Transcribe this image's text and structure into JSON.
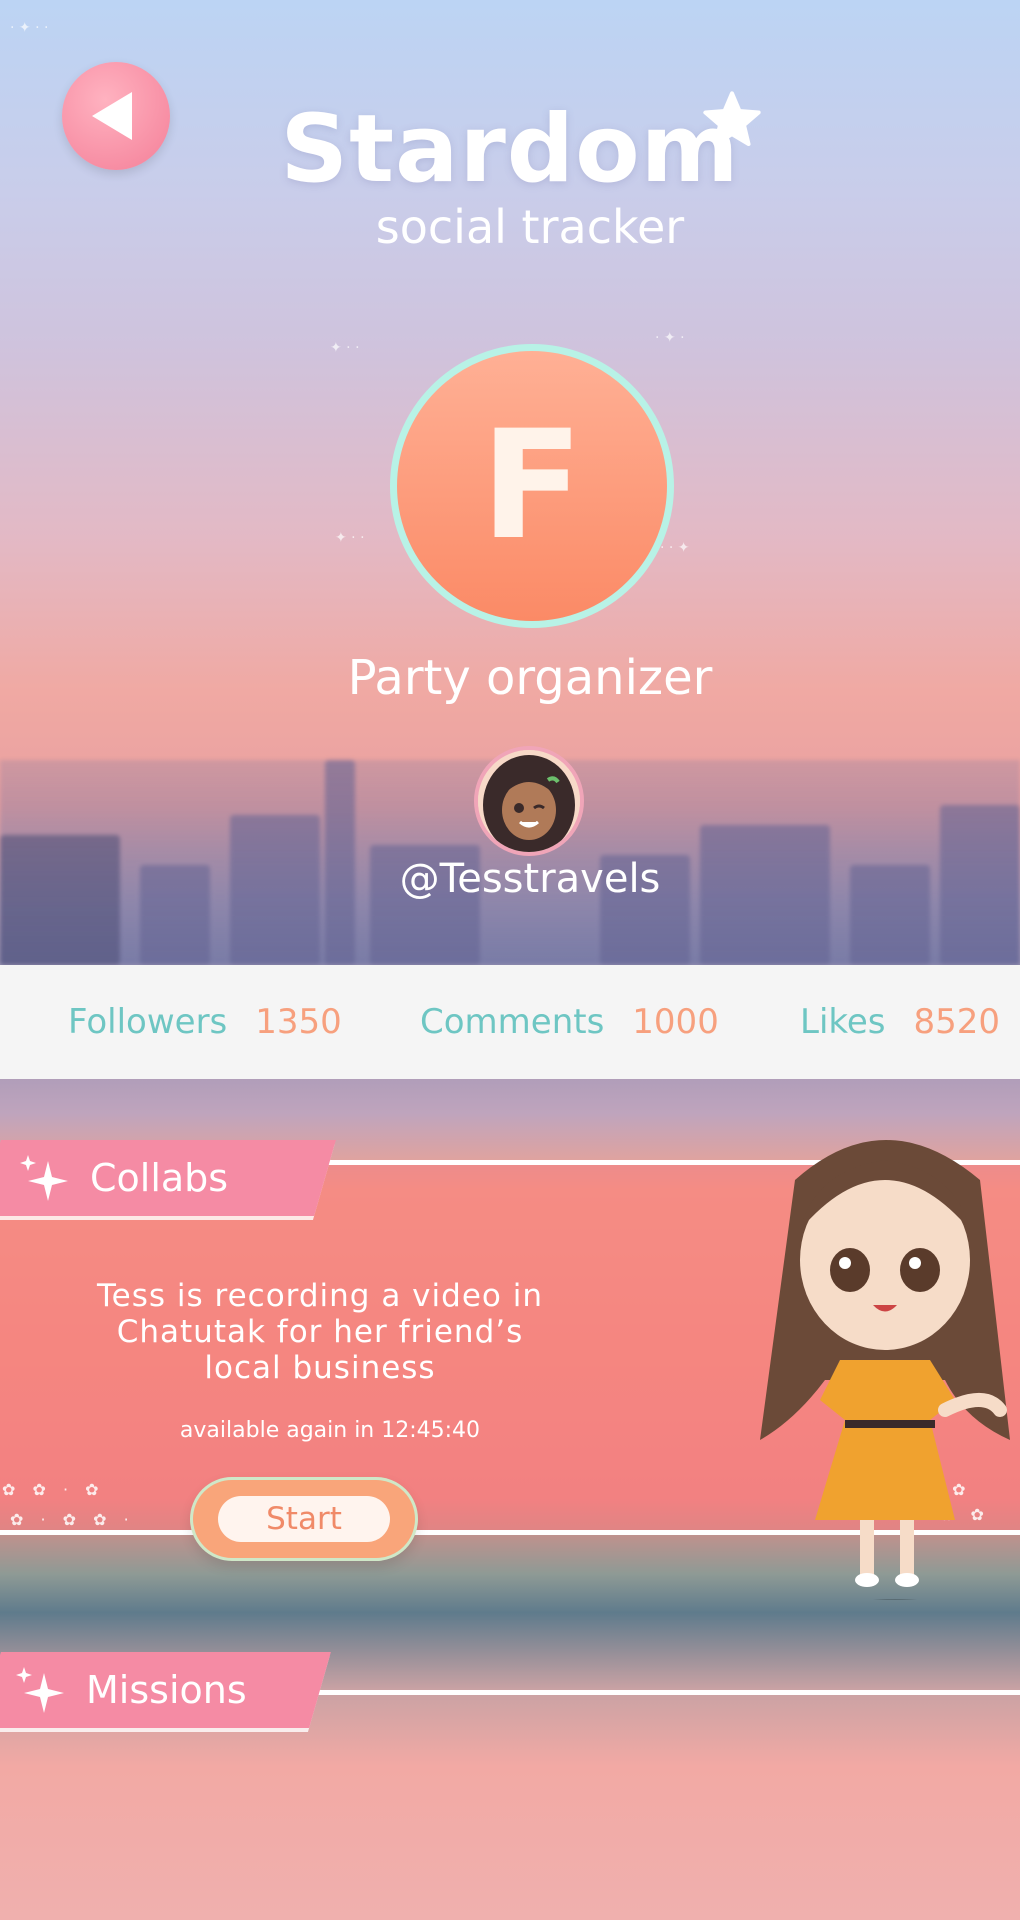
{
  "app": {
    "title": "Stardom",
    "subtitle": "social tracker"
  },
  "icons": {
    "back": "back-arrow-icon",
    "star": "star-icon",
    "sparkle": "sparkle-icon"
  },
  "profile": {
    "rank_letter": "F",
    "role": "Party organizer",
    "handle": "@Tesstravels"
  },
  "stats": [
    {
      "label": "Followers",
      "value": "1350"
    },
    {
      "label": "Comments",
      "value": "1000"
    },
    {
      "label": "Likes",
      "value": "8520"
    }
  ],
  "collabs": {
    "header": "Collabs",
    "description": "Tess is recording a video in Chatutak for her friend’s local business",
    "timer": "available again in 12:45:40",
    "start_label": "Start"
  },
  "missions": {
    "header": "Missions"
  },
  "colors": {
    "accent_pink": "#f58ba4",
    "teal_label": "#6ec6c3",
    "orange_value": "#f7a07e",
    "badge_orange": "#fb8a66",
    "badge_ring": "#b8f2e6"
  }
}
